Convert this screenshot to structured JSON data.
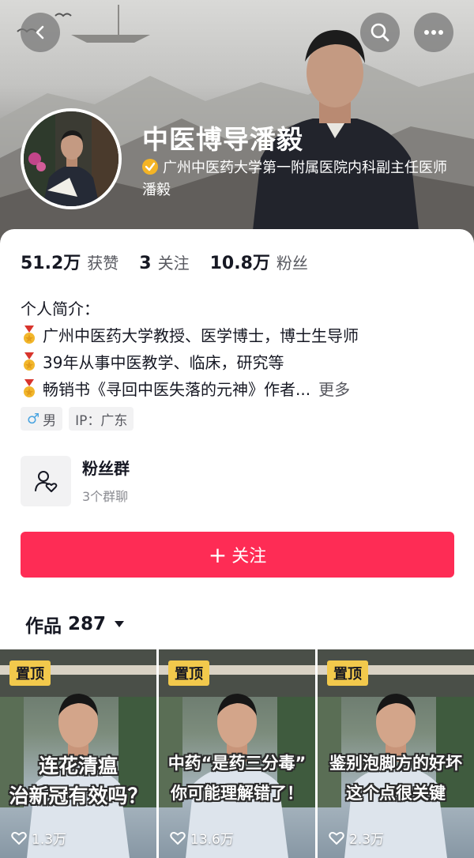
{
  "header": {
    "nickname": "中医博导潘毅",
    "verification": "广州中医药大学第一附属医院内科副主任医师 潘毅"
  },
  "icons": {
    "back": "chevron-left-icon",
    "search": "search-icon",
    "more": "more-dots-icon",
    "verified": "verified-badge-icon",
    "medal": "medal-icon",
    "fans_group": "group-heart-icon",
    "caret": "caret-down-icon",
    "like": "heart-outline-icon"
  },
  "stats": [
    {
      "value": "51.2万",
      "label": "获赞"
    },
    {
      "value": "3",
      "label": "关注"
    },
    {
      "value": "10.8万",
      "label": "粉丝"
    }
  ],
  "bio": {
    "title": "个人简介：",
    "lines": [
      "广州中医药大学教授、医学博士，博士生导师",
      "39年从事中医教学、临床，研究等",
      "畅销书《寻回中医失落的元神》作者..."
    ],
    "more": "更多"
  },
  "tags": {
    "gender_symbol": "♂",
    "gender": "男",
    "ip": "IP：广东"
  },
  "fans_group": {
    "title": "粉丝群",
    "subtitle": "3个群聊"
  },
  "follow_button": {
    "plus": "+",
    "label": "关注"
  },
  "works": {
    "label": "作品",
    "count": "287"
  },
  "videos": [
    {
      "pin": "置顶",
      "line1": "连花清瘟",
      "line2": "治新冠有效吗？",
      "likes": "1.3万"
    },
    {
      "pin": "置顶",
      "line1": "中药“是药三分毒”",
      "line2": "你可能理解错了！",
      "likes": "13.6万"
    },
    {
      "pin": "置顶",
      "line1": "鉴别泡脚方的好坏",
      "line2": "这个点很关键",
      "likes": "2.3万"
    }
  ],
  "colors": {
    "accent": "#fe2c55",
    "pin": "#f2c94c",
    "verified": "#f4b425",
    "gender": "#4aa4e0"
  }
}
